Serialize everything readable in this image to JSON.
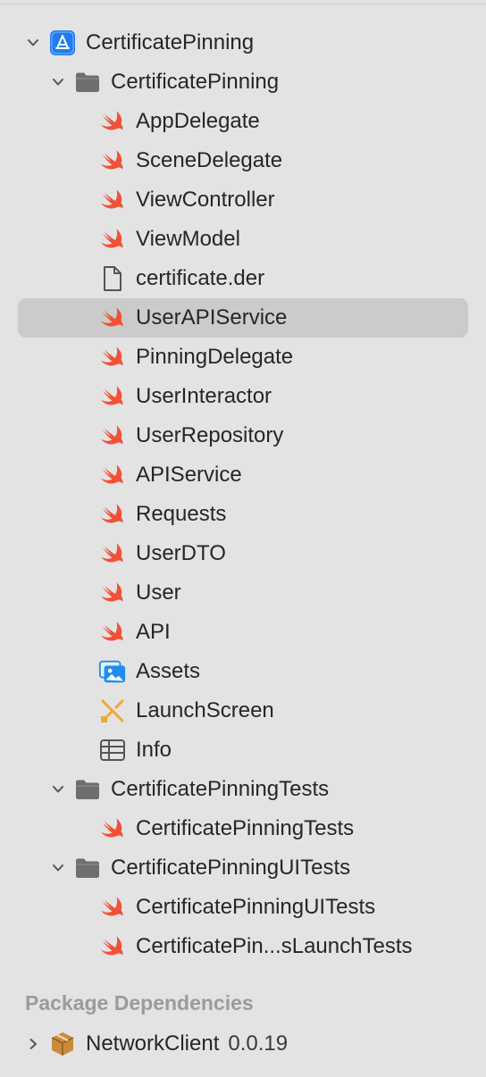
{
  "project": {
    "name": "CertificatePinning",
    "groups": [
      {
        "name": "CertificatePinning",
        "items": [
          {
            "name": "AppDelegate",
            "icon": "swift-file-icon"
          },
          {
            "name": "SceneDelegate",
            "icon": "swift-file-icon"
          },
          {
            "name": "ViewController",
            "icon": "swift-file-icon"
          },
          {
            "name": "ViewModel",
            "icon": "swift-file-icon"
          },
          {
            "name": "certificate.der",
            "icon": "document-icon"
          },
          {
            "name": "UserAPIService",
            "icon": "swift-file-icon",
            "selected": true
          },
          {
            "name": "PinningDelegate",
            "icon": "swift-file-icon"
          },
          {
            "name": "UserInteractor",
            "icon": "swift-file-icon"
          },
          {
            "name": "UserRepository",
            "icon": "swift-file-icon"
          },
          {
            "name": "APIService",
            "icon": "swift-file-icon"
          },
          {
            "name": "Requests",
            "icon": "swift-file-icon"
          },
          {
            "name": "UserDTO",
            "icon": "swift-file-icon"
          },
          {
            "name": "User",
            "icon": "swift-file-icon"
          },
          {
            "name": "API",
            "icon": "swift-file-icon"
          },
          {
            "name": "Assets",
            "icon": "asset-catalog-icon"
          },
          {
            "name": "LaunchScreen",
            "icon": "storyboard-icon"
          },
          {
            "name": "Info",
            "icon": "plist-icon"
          }
        ]
      },
      {
        "name": "CertificatePinningTests",
        "items": [
          {
            "name": "CertificatePinningTests",
            "icon": "swift-file-icon"
          }
        ]
      },
      {
        "name": "CertificatePinningUITests",
        "items": [
          {
            "name": "CertificatePinningUITests",
            "icon": "swift-file-icon"
          },
          {
            "name": "CertificatePin...sLaunchTests",
            "icon": "swift-file-icon"
          }
        ]
      }
    ]
  },
  "package_dependencies": {
    "header": "Package Dependencies",
    "packages": [
      {
        "name": "NetworkClient",
        "version": "0.0.19"
      }
    ]
  },
  "colors": {
    "swift": "#f05138",
    "accent": "#1f7cf2",
    "selection": "#cbcbcb",
    "folder": "#6e6e6e",
    "package": "#c98a3c"
  }
}
